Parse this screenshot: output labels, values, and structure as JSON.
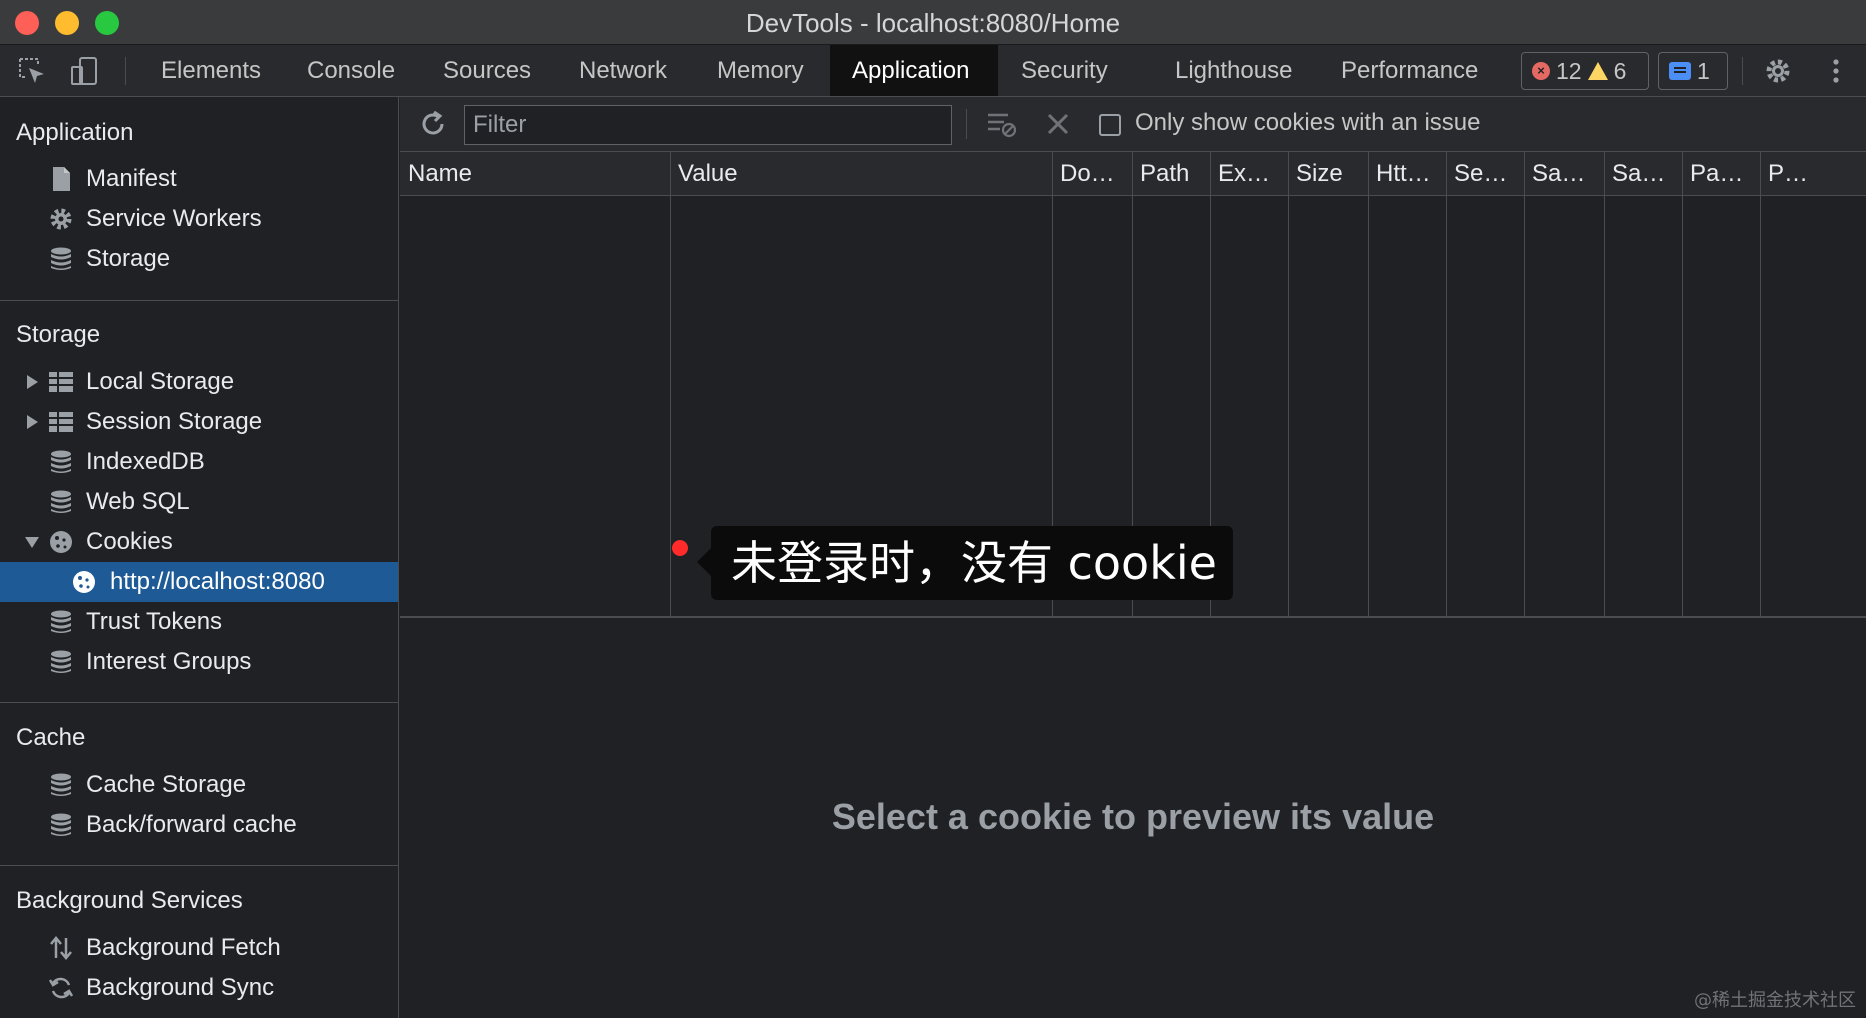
{
  "window": {
    "title": "DevTools - localhost:8080/Home"
  },
  "tabs": [
    {
      "label": "Elements"
    },
    {
      "label": "Console"
    },
    {
      "label": "Sources"
    },
    {
      "label": "Network"
    },
    {
      "label": "Memory"
    },
    {
      "label": "Application"
    },
    {
      "label": "Security"
    },
    {
      "label": "Lighthouse"
    },
    {
      "label": "Performance"
    }
  ],
  "active_tab": "Application",
  "badges": {
    "errors": "12",
    "warnings": "6",
    "messages": "1"
  },
  "sidebar": {
    "application": {
      "header": "Application",
      "items": [
        {
          "label": "Manifest",
          "icon": "file-icon"
        },
        {
          "label": "Service Workers",
          "icon": "gear-icon"
        },
        {
          "label": "Storage",
          "icon": "database-icon"
        }
      ]
    },
    "storage": {
      "header": "Storage",
      "items": [
        {
          "label": "Local Storage",
          "icon": "table-icon"
        },
        {
          "label": "Session Storage",
          "icon": "table-icon"
        },
        {
          "label": "IndexedDB",
          "icon": "database-icon"
        },
        {
          "label": "Web SQL",
          "icon": "database-icon"
        },
        {
          "label": "Cookies",
          "icon": "cookie-icon"
        },
        {
          "label": "http://localhost:8080",
          "icon": "cookie-icon"
        },
        {
          "label": "Trust Tokens",
          "icon": "database-icon"
        },
        {
          "label": "Interest Groups",
          "icon": "database-icon"
        }
      ]
    },
    "cache": {
      "header": "Cache",
      "items": [
        {
          "label": "Cache Storage",
          "icon": "database-icon"
        },
        {
          "label": "Back/forward cache",
          "icon": "database-icon"
        }
      ]
    },
    "background": {
      "header": "Background Services",
      "items": [
        {
          "label": "Background Fetch",
          "icon": "arrows-icon"
        },
        {
          "label": "Background Sync",
          "icon": "sync-icon"
        }
      ]
    }
  },
  "toolbar": {
    "filter_placeholder": "Filter",
    "only_issues_label": "Only show cookies with an issue"
  },
  "table": {
    "columns": [
      "Name",
      "Value",
      "Do…",
      "Path",
      "Ex…",
      "Size",
      "Htt…",
      "Se…",
      "Sa…",
      "Sa…",
      "Pa…",
      "P…"
    ]
  },
  "annotation": {
    "text": "未登录时，没有 cookie"
  },
  "preview": {
    "empty_text": "Select a cookie to preview its value"
  },
  "watermark": "@稀土掘金技术社区",
  "colors": {
    "accent": "#1e5a96",
    "active_tab_bg": "#111112",
    "annotation_dot": "#ff2a2a"
  }
}
